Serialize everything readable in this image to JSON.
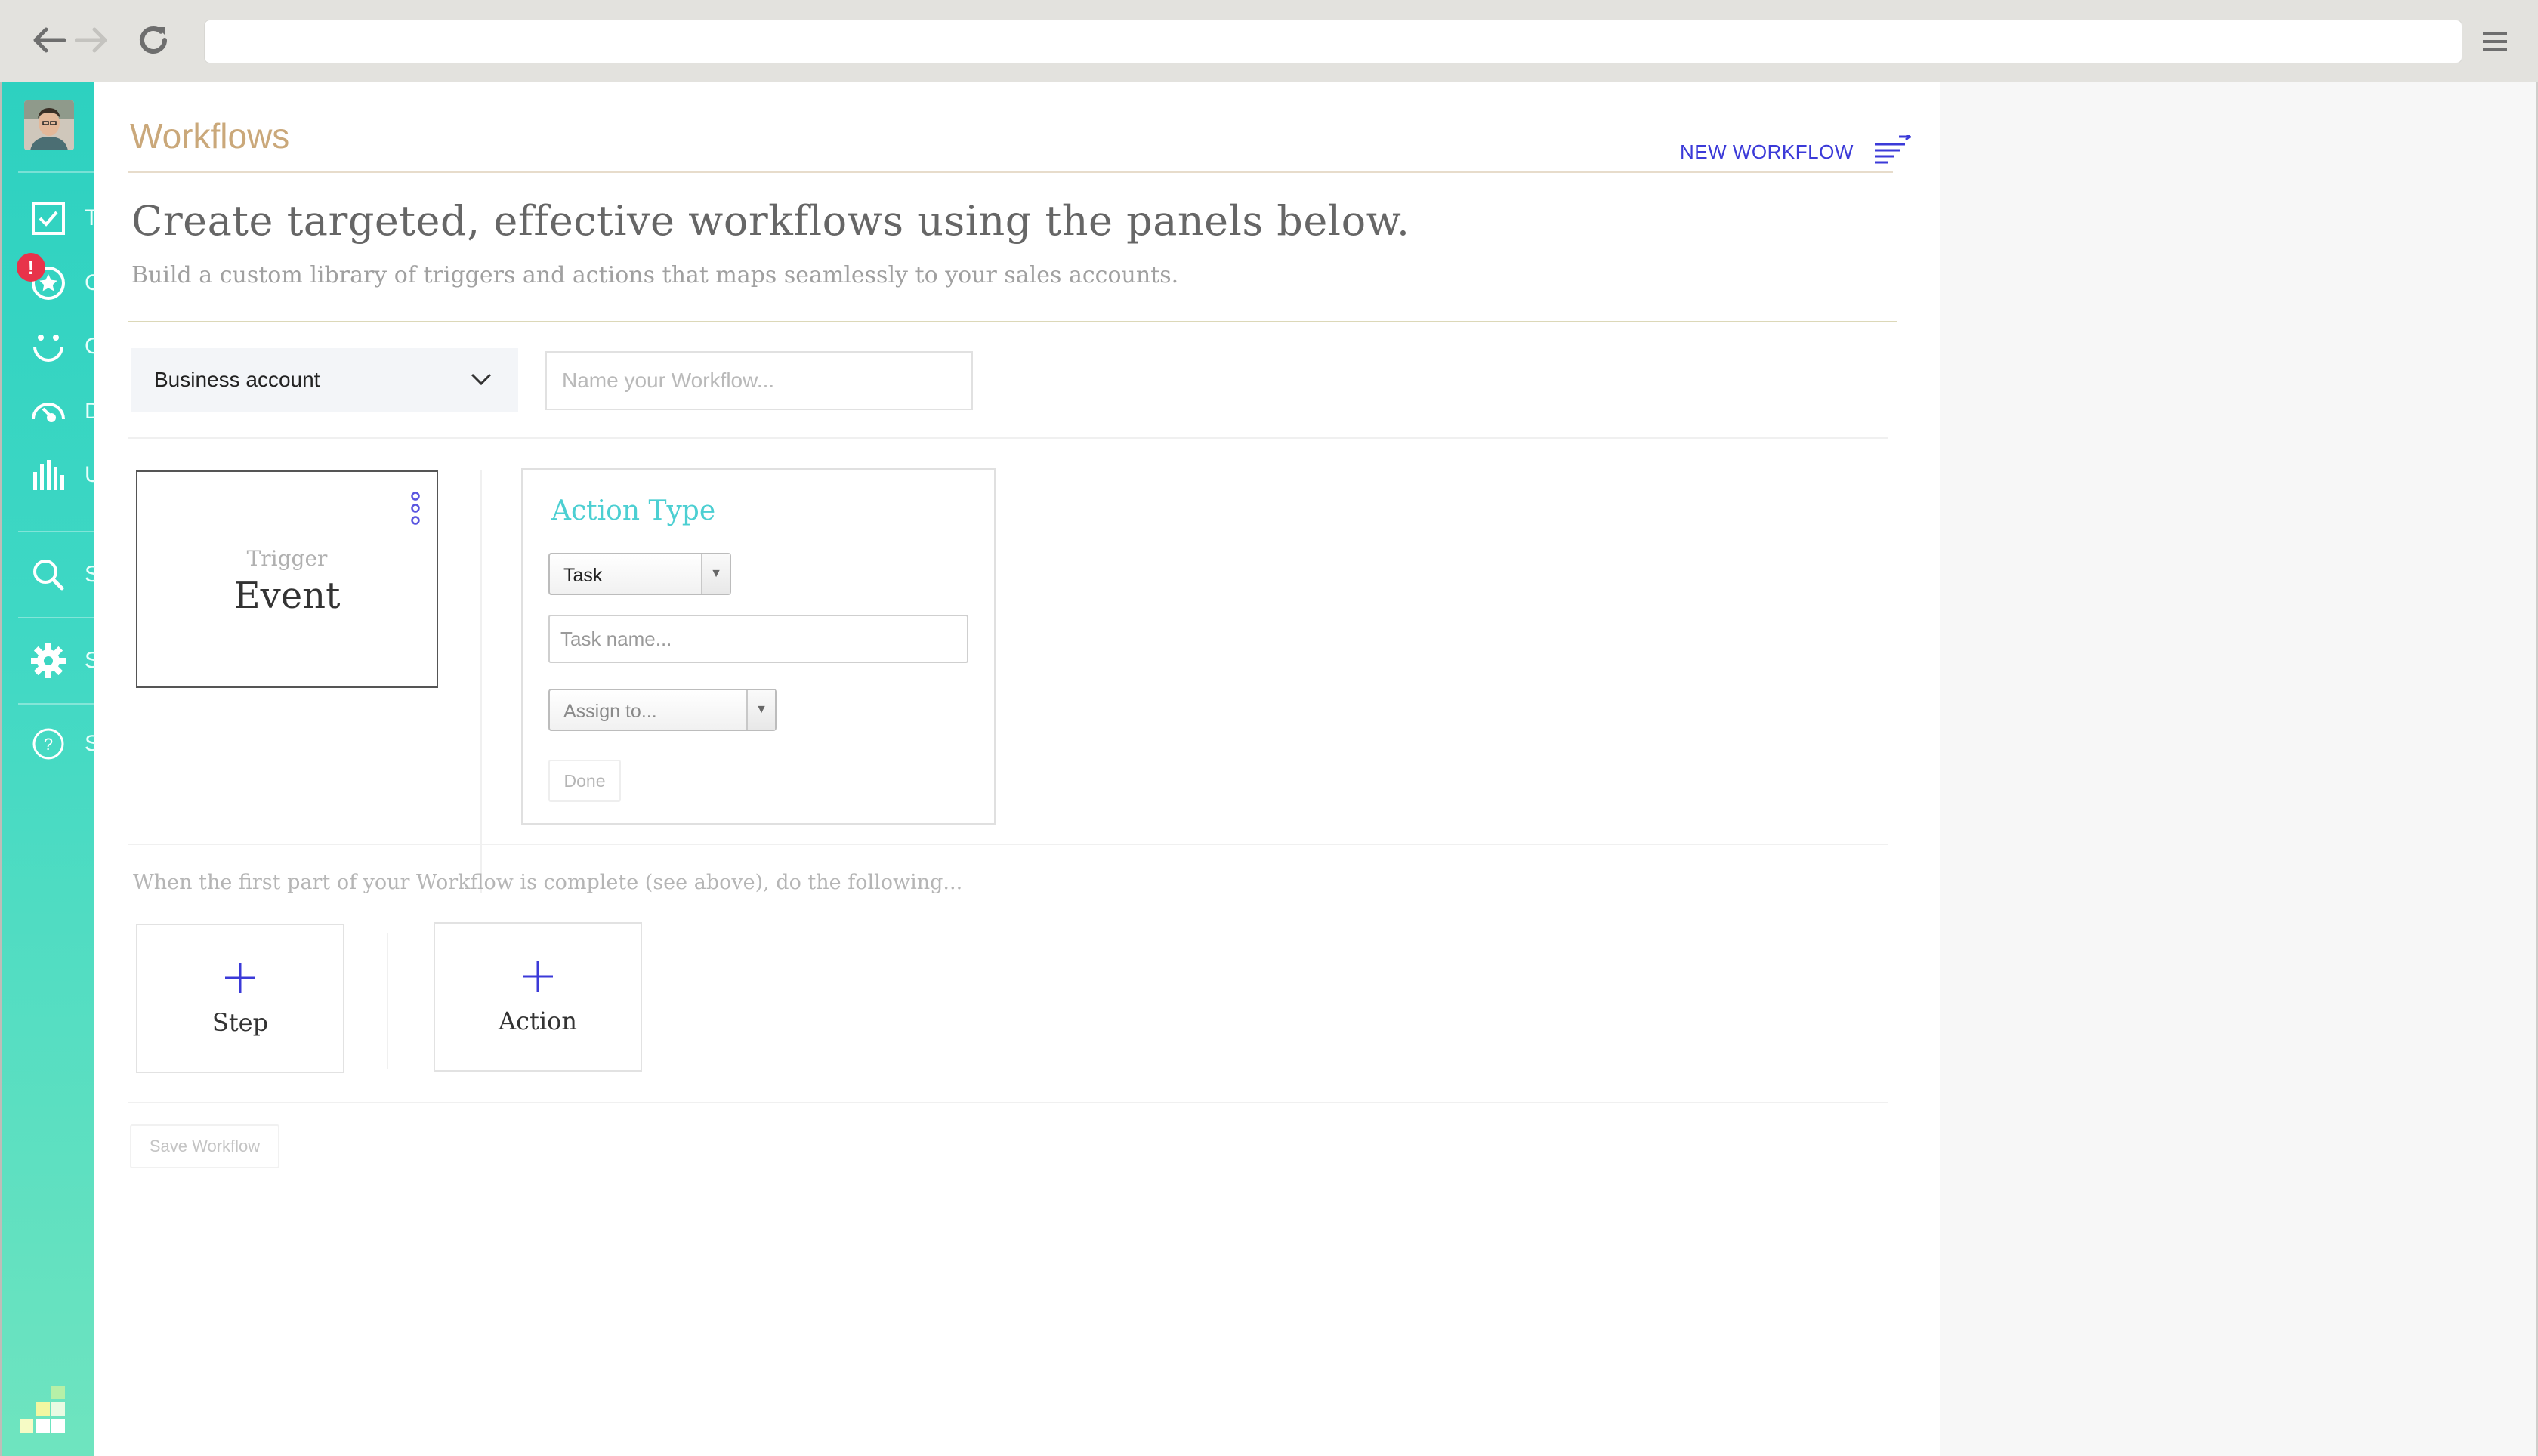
{
  "app": {
    "title": "Workflows",
    "new_workflow_label": "NEW WORKFLOW",
    "accent": "#2dd1c0",
    "link_color": "#3b3ad8"
  },
  "browser": {
    "icons": [
      "back-arrow-icon",
      "forward-arrow-icon",
      "reload-icon",
      "hamburger-menu-icon"
    ],
    "address": ""
  },
  "sidebar": {
    "items": [
      {
        "icon": "checkbox-icon",
        "label": "T"
      },
      {
        "icon": "star-circle-icon",
        "label": "C",
        "badge": "!"
      },
      {
        "icon": "smiley-icon",
        "label": "C"
      },
      {
        "icon": "gauge-icon",
        "label": "D"
      },
      {
        "icon": "bar-chart-icon",
        "label": "U"
      },
      {
        "icon": "search-icon",
        "label": "S"
      },
      {
        "icon": "gear-icon",
        "label": "S"
      },
      {
        "icon": "help-icon",
        "label": "S"
      }
    ]
  },
  "header": {
    "headline": "Create targeted, effective workflows using the panels below.",
    "subhead": "Build a custom library of triggers and actions that maps seamlessly to your sales accounts."
  },
  "form": {
    "account_select_value": "Business account",
    "name_placeholder": "Name your Workflow..."
  },
  "trigger": {
    "label": "Trigger",
    "value": "Event"
  },
  "action_panel": {
    "title": "Action Type",
    "type_value": "Task",
    "task_name_placeholder": "Task name...",
    "assign_value": "Assign to...",
    "done_label": "Done"
  },
  "followup": {
    "instruction": "When the first part of your Workflow is complete (see above), do the following...",
    "step_label": "Step",
    "action_label": "Action"
  },
  "footer": {
    "save_label": "Save Workflow"
  }
}
